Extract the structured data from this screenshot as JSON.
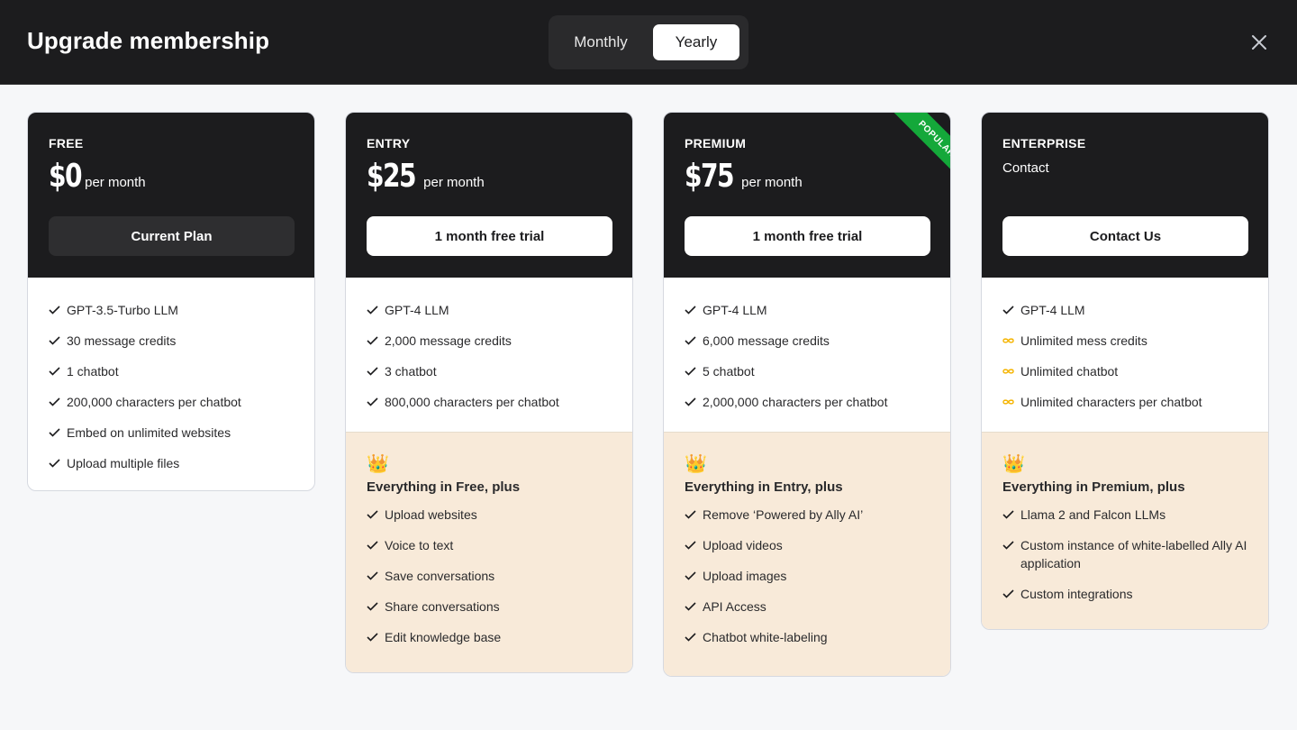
{
  "header": {
    "title": "Upgrade membership",
    "toggle": {
      "monthly": "Monthly",
      "yearly": "Yearly",
      "selected": "Yearly"
    },
    "close_icon": "close-icon"
  },
  "colors": {
    "dark": "#1c1c1e",
    "popular": "#14a83a",
    "highlight_bg": "#f8ead9",
    "infinity": "#f5b400"
  },
  "plans": [
    {
      "tier": "FREE",
      "price": "$0",
      "per": "per month",
      "cta": "Current Plan",
      "features": [
        {
          "icon": "check-icon",
          "text": "GPT-3.5-Turbo LLM"
        },
        {
          "icon": "check-icon",
          "text": "30 message credits"
        },
        {
          "icon": "check-icon",
          "text": "1 chatbot"
        },
        {
          "icon": "check-icon",
          "text": "200,000 characters per chatbot"
        },
        {
          "icon": "check-icon",
          "text": "Embed on unlimited websites"
        },
        {
          "icon": "check-icon",
          "text": "Upload multiple files"
        }
      ]
    },
    {
      "tier": "ENTRY",
      "price": "$25",
      "per": "per month",
      "cta": "1 month free trial",
      "features": [
        {
          "icon": "check-icon",
          "text": "GPT-4 LLM"
        },
        {
          "icon": "check-icon",
          "text": "2,000 message credits"
        },
        {
          "icon": "check-icon",
          "text": "3 chatbot"
        },
        {
          "icon": "check-icon",
          "text": "800,000 characters per chatbot"
        }
      ],
      "extra_icon": "crown-icon",
      "extra_title": "Everything in Free, plus",
      "extras": [
        "Upload websites",
        "Voice to text",
        "Save conversations",
        "Share conversations",
        "Edit knowledge base"
      ]
    },
    {
      "tier": "PREMIUM",
      "price": "$75",
      "per": "per month",
      "cta": "1 month free trial",
      "badge": "POPULAR",
      "features": [
        {
          "icon": "check-icon",
          "text": "GPT-4 LLM"
        },
        {
          "icon": "check-icon",
          "text": "6,000 message credits"
        },
        {
          "icon": "check-icon",
          "text": "5 chatbot"
        },
        {
          "icon": "check-icon",
          "text": "2,000,000 characters per chatbot"
        }
      ],
      "extra_icon": "crown-icon",
      "extra_title": "Everything in Entry, plus",
      "extras": [
        "Remove ‘Powered by Ally AI’",
        "Upload videos",
        "Upload images",
        "API Access",
        "Chatbot white-labeling"
      ]
    },
    {
      "tier": "ENTERPRISE",
      "price_text": "Contact",
      "cta": "Contact Us",
      "features": [
        {
          "icon": "check-icon",
          "text": "GPT-4 LLM"
        },
        {
          "icon": "infinity-icon",
          "text": "Unlimited mess credits"
        },
        {
          "icon": "infinity-icon",
          "text": "Unlimited chatbot"
        },
        {
          "icon": "infinity-icon",
          "text": "Unlimited characters per chatbot"
        }
      ],
      "extra_icon": "crown-icon",
      "extra_title": "Everything in Premium, plus",
      "extras": [
        "Llama 2 and Falcon LLMs",
        "Custom instance of white-labelled Ally AI application",
        "Custom integrations"
      ]
    }
  ]
}
